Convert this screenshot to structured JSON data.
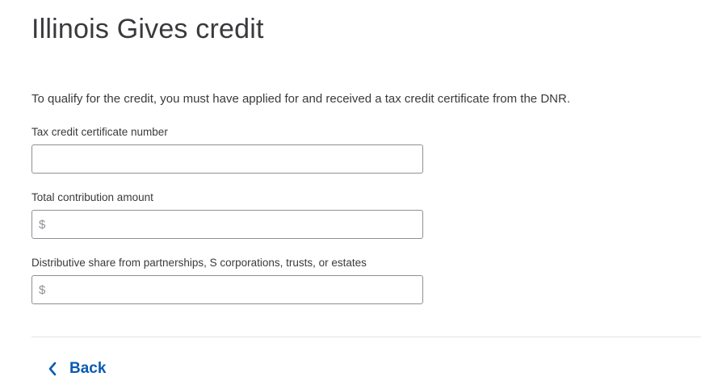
{
  "header": {
    "title": "Illinois Gives credit"
  },
  "intro": {
    "text": "To qualify for the credit, you must have applied for and received a tax credit certificate from the DNR."
  },
  "fields": {
    "certificate_number": {
      "label": "Tax credit certificate number",
      "value": "",
      "placeholder": ""
    },
    "total_contribution": {
      "label": "Total contribution amount",
      "prefix": "$",
      "value": "",
      "placeholder": ""
    },
    "distributive_share": {
      "label": "Distributive share from partnerships, S corporations, trusts, or estates",
      "prefix": "$",
      "value": "",
      "placeholder": ""
    }
  },
  "footer": {
    "back_label": "Back",
    "back_icon": "chevron-left-icon"
  },
  "colors": {
    "text": "#393a3d",
    "link": "#0a5bb1",
    "border": "#8d9096",
    "divider": "#dfe3e6"
  }
}
